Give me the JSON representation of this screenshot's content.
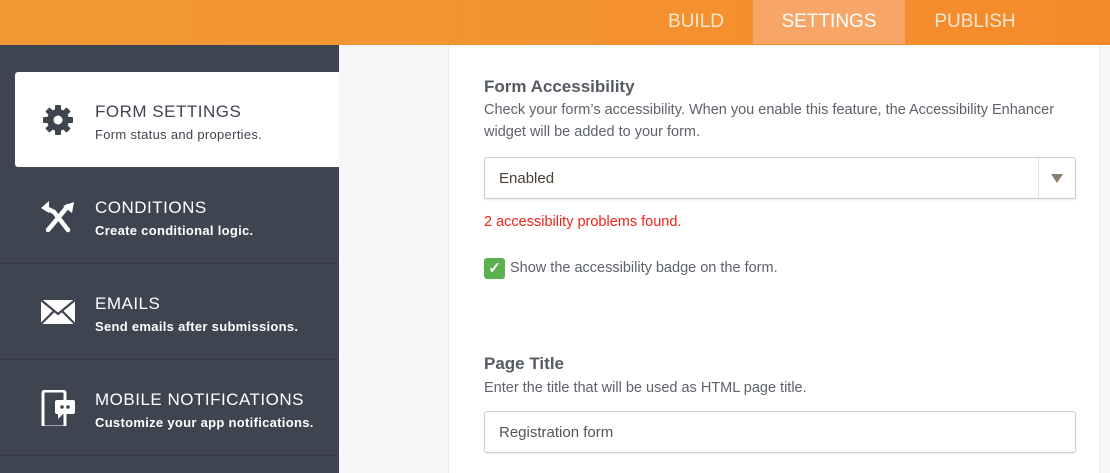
{
  "nav": {
    "tabs": [
      {
        "label": "BUILD"
      },
      {
        "label": "SETTINGS"
      },
      {
        "label": "PUBLISH"
      }
    ],
    "active": "SETTINGS"
  },
  "sidebar": {
    "items": [
      {
        "title": "FORM SETTINGS",
        "subtitle": "Form status and properties.",
        "icon": "gear-icon"
      },
      {
        "title": "CONDITIONS",
        "subtitle": "Create conditional logic.",
        "icon": "conditions-arrows-icon"
      },
      {
        "title": "EMAILS",
        "subtitle": "Send emails after submissions.",
        "icon": "envelope-icon"
      },
      {
        "title": "MOBILE NOTIFICATIONS",
        "subtitle": "Customize your app notifications.",
        "icon": "mobile-notification-icon"
      }
    ]
  },
  "accessibility": {
    "heading": "Form Accessibility",
    "description": "Check your form’s accessibility. When you enable this feature, the Accessibility Enhancer widget will be added to your form.",
    "select_value": "Enabled",
    "error": "2 accessibility problems found.",
    "badge_label": "Show the accessibility badge on the form.",
    "badge_checked": true
  },
  "page_title": {
    "heading": "Page Title",
    "description": "Enter the title that will be used as HTML page title.",
    "value": "Registration form"
  },
  "colors": {
    "header": "#f5902f",
    "sidebar": "#3e4450",
    "error": "#f0241b",
    "check": "#5bb04f"
  }
}
